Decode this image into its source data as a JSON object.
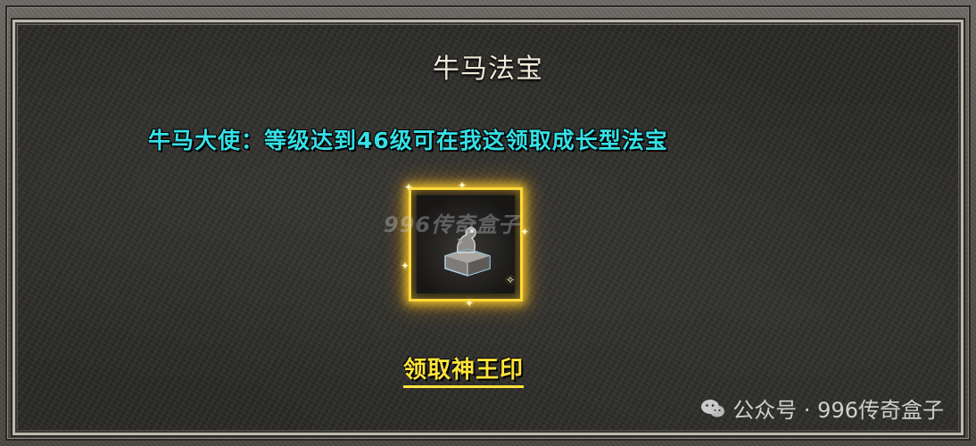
{
  "dialog": {
    "title": "牛马法宝",
    "npc_line": "牛马大使：等级达到46级可在我这领取成长型法宝",
    "item": {
      "icon": "statue-seal-icon",
      "rarity_color": "#ffd83a"
    },
    "claim_label": "领取神王印"
  },
  "overlay": {
    "center_watermark": "996传奇盒子",
    "wechat_account": "公众号 · 996传奇盒子"
  },
  "colors": {
    "title": "#f1ead8",
    "npc_text": "#35e0e6",
    "claim_text": "#ffe43a",
    "slot_glow": "#ffd83a"
  }
}
